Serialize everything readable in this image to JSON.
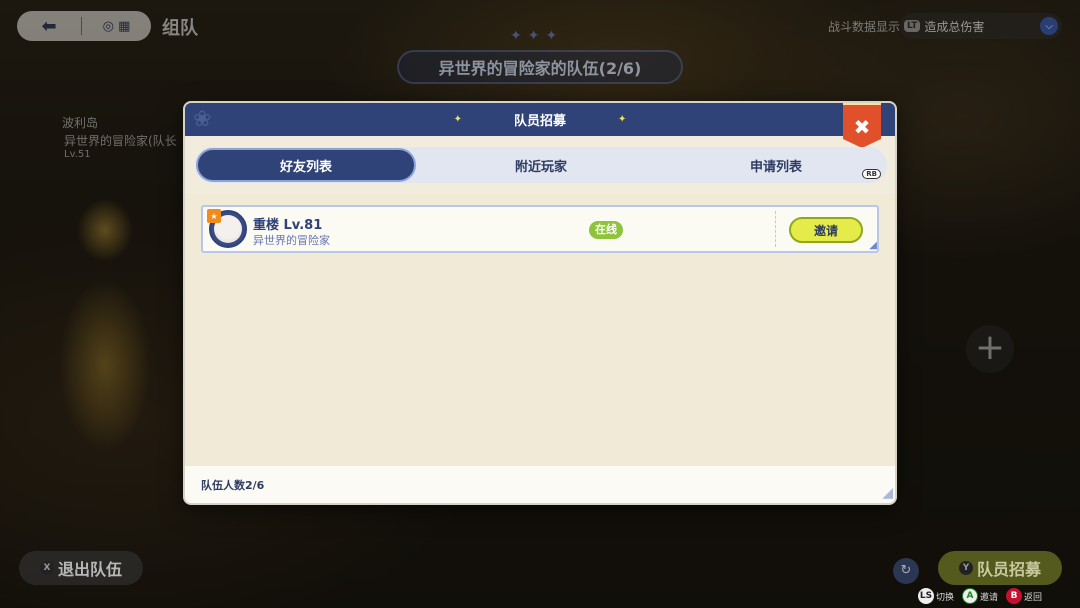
{
  "top_bar": {
    "title": "组队",
    "battle_data_label": "战斗数据显示",
    "damage_key": "LT",
    "damage_option": "造成总伤害"
  },
  "team_banner": "异世界的冒险家的队伍(2/6)",
  "member": {
    "location": "波利岛",
    "name": "异世界的冒险家(队长",
    "level": "Lv.51"
  },
  "modal": {
    "title": "队员招募",
    "tabs": [
      "好友列表",
      "附近玩家",
      "申请列表"
    ],
    "active_tab": 0,
    "rb_key": "RB",
    "friends": [
      {
        "name": "重楼  Lv.81",
        "title": "异世界的冒险家",
        "status": "在线",
        "action": "邀请"
      }
    ],
    "footer_count": "队伍人数2/6"
  },
  "bottom": {
    "exit_key": "X",
    "exit_label": "退出队伍",
    "recruit_key": "Y",
    "recruit_label": "队员招募",
    "hints": [
      {
        "key": "LS",
        "label": "切换"
      },
      {
        "key": "A",
        "label": "邀请"
      },
      {
        "key": "B",
        "label": "返回"
      }
    ]
  },
  "colors": {
    "header_blue": "#2f4378",
    "panel_bg": "#f1ecdc",
    "online_green": "#8ec43c",
    "invite_yellow": "#e5ec4a",
    "close_red": "#e0502b"
  }
}
